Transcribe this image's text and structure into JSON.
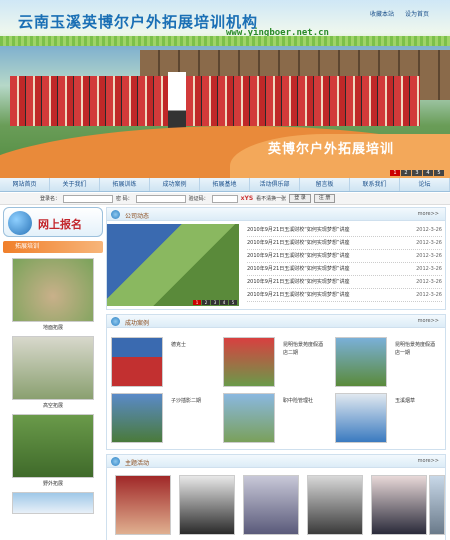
{
  "header": {
    "title": "云南玉溪英博尔户外拓展培训机构",
    "url": "www.yingboer.net.cn",
    "links": [
      "收藏本站",
      "设为首页"
    ]
  },
  "banner": {
    "slogan": "英博尔户外拓展培训",
    "pages": [
      "1",
      "2",
      "3",
      "4",
      "5"
    ]
  },
  "nav": {
    "items": [
      "网站首页",
      "关于我们",
      "拓展训练",
      "成功案例",
      "拓展基地",
      "活动俱乐部",
      "留言板",
      "联系我们",
      "论坛"
    ]
  },
  "login": {
    "user_label": "登录名：",
    "pass_label": "密 码：",
    "code_label": "验证码：",
    "code_value": "xYS",
    "hint": "看不清换一张",
    "login_button": "登 录",
    "register_button": "注 册"
  },
  "left": {
    "signup": "网上报名",
    "section_title": "拓展培训",
    "items": [
      "地面拓展",
      "高空拓展",
      "野外拓展"
    ]
  },
  "company_news": {
    "title": "公司动态",
    "more": "more>>",
    "slider_pages": [
      "1",
      "2",
      "3",
      "4",
      "5"
    ],
    "items": [
      {
        "title": "2010年9月21日玉溪财校“如何实现梦想”讲座",
        "date": "2012-3-26"
      },
      {
        "title": "2010年9月21日玉溪财校“如何实现梦想”讲座",
        "date": "2012-3-26"
      },
      {
        "title": "2010年9月21日玉溪财校“如何实现梦想”讲座",
        "date": "2012-3-26"
      },
      {
        "title": "2010年9月21日玉溪财校“如何实现梦想”讲座",
        "date": "2012-3-26"
      },
      {
        "title": "2010年9月21日玉溪财校“如何实现梦想”讲座",
        "date": "2012-3-26"
      },
      {
        "title": "2010年9月21日玉溪财校“如何实现梦想”讲座",
        "date": "2012-3-26"
      }
    ]
  },
  "cases": {
    "title": "成功案例",
    "more": "more>>",
    "items": [
      "德克士",
      "昆明怡景苑度假酒店二期",
      "昆明怡景苑度假酒店一期",
      "子沙插影二期",
      "职中险管理社",
      "玉溪烟草"
    ]
  },
  "activities": {
    "title": "主题活动",
    "more": "more>>"
  }
}
